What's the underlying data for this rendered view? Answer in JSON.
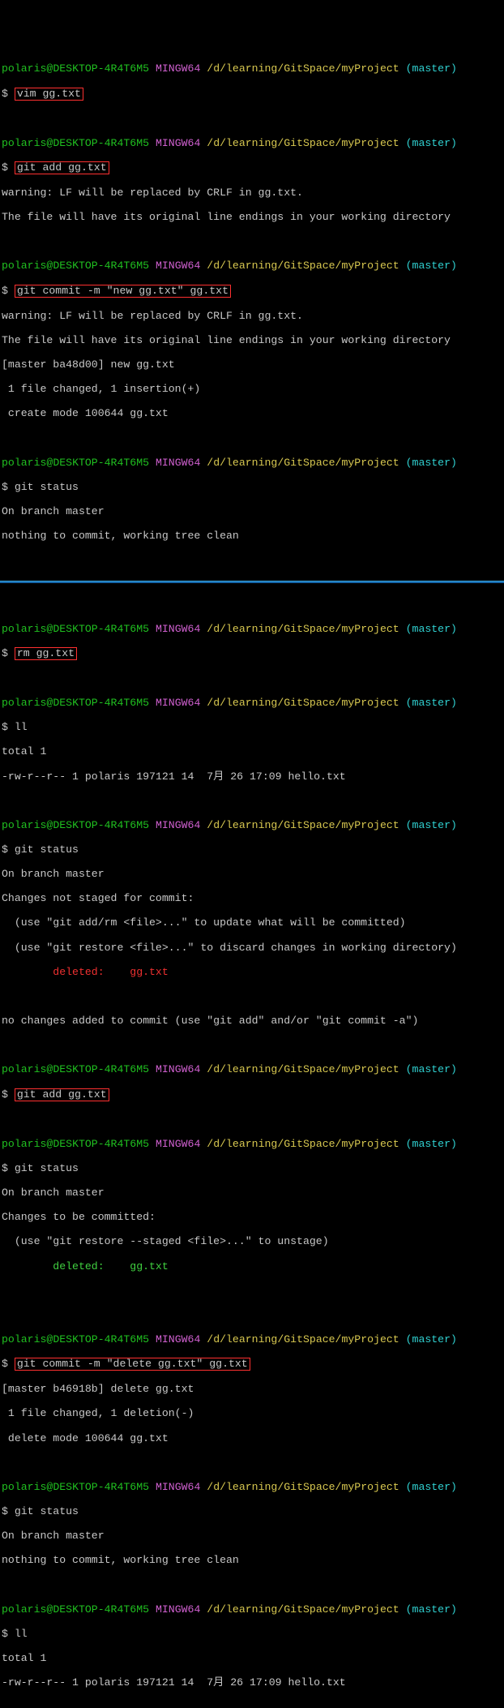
{
  "prompt": {
    "user": "polaris",
    "at": "@",
    "host": "DESKTOP-4R4T6M5",
    "env": " MINGW64 ",
    "path": "/d/learning/GitSpace/myProject",
    "branch": " (master)"
  },
  "dollar": "$ ",
  "s1": {
    "cmd1": "vim gg.txt",
    "cmd2": "git add gg.txt",
    "out2a": "warning: LF will be replaced by CRLF in gg.txt.",
    "out2b": "The file will have its original line endings in your working directory",
    "cmd3": "git commit -m \"new gg.txt\" gg.txt",
    "out3a": "warning: LF will be replaced by CRLF in gg.txt.",
    "out3b": "The file will have its original line endings in your working directory",
    "out3c": "[master ba48d00] new gg.txt",
    "out3d": " 1 file changed, 1 insertion(+)",
    "out3e": " create mode 100644 gg.txt",
    "cmd4": "git status",
    "out4a": "On branch master",
    "out4b": "nothing to commit, working tree clean"
  },
  "s2": {
    "cmd1": "rm gg.txt",
    "cmd2": "ll",
    "out2a": "total 1",
    "out2b": "-rw-r--r-- 1 polaris 197121 14  7月 26 17:09 hello.txt",
    "cmd3": "git status",
    "out3a": "On branch master",
    "out3b": "Changes not staged for commit:",
    "out3c": "  (use \"git add/rm <file>...\" to update what will be committed)",
    "out3d": "  (use \"git restore <file>...\" to discard changes in working directory)",
    "out3e": "        deleted:    gg.txt",
    "out3f": "no changes added to commit (use \"git add\" and/or \"git commit -a\")",
    "cmd4": "git add gg.txt",
    "cmd5": "git status",
    "out5a": "On branch master",
    "out5b": "Changes to be committed:",
    "out5c": "  (use \"git restore --staged <file>...\" to unstage)",
    "out5d": "        deleted:    gg.txt",
    "cmd6": "git commit -m \"delete gg.txt\" gg.txt",
    "out6a": "[master b46918b] delete gg.txt",
    "out6b": " 1 file changed, 1 deletion(-)",
    "out6c": " delete mode 100644 gg.txt",
    "cmd7": "git status",
    "out7a": "On branch master",
    "out7b": "nothing to commit, working tree clean",
    "cmd8": "ll",
    "out8a": "total 1",
    "out8b": "-rw-r--r-- 1 polaris 197121 14  7月 26 17:09 hello.txt"
  }
}
